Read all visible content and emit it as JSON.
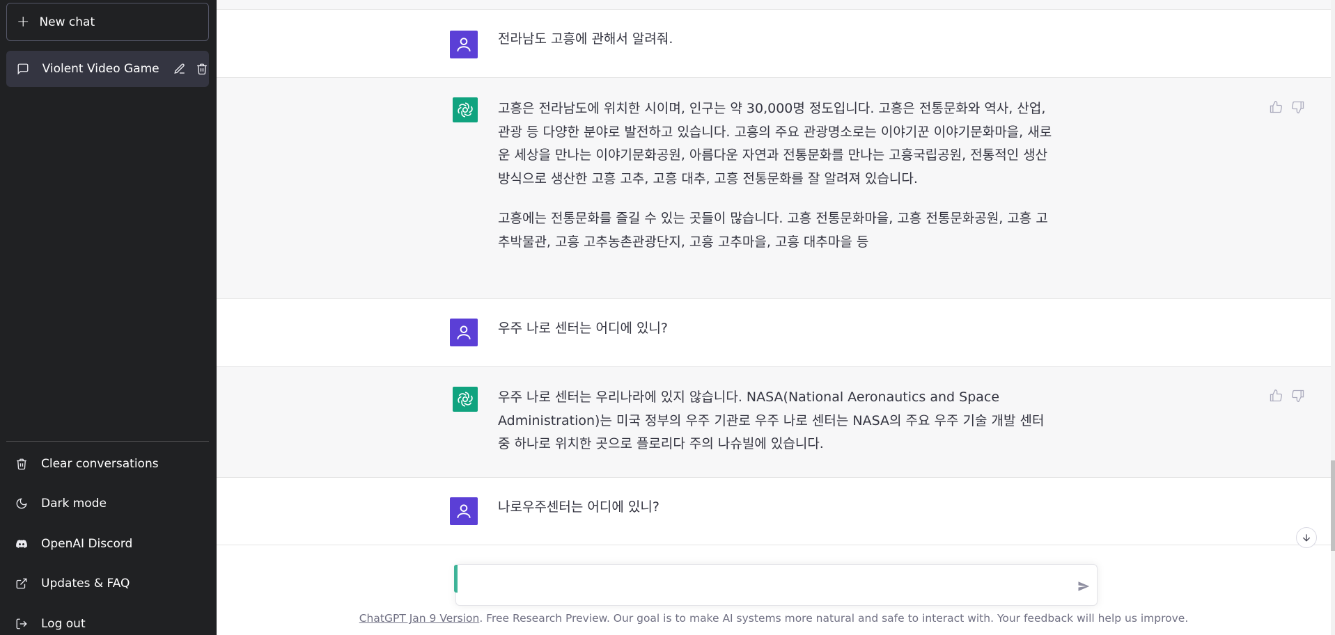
{
  "sidebar": {
    "new_chat_label": "New chat",
    "conversations": [
      {
        "title": "Violent Video Game Is"
      }
    ],
    "menu": [
      {
        "label": "Clear conversations",
        "icon": "trash-icon"
      },
      {
        "label": "Dark mode",
        "icon": "moon-icon"
      },
      {
        "label": "OpenAI Discord",
        "icon": "discord-icon"
      },
      {
        "label": "Updates & FAQ",
        "icon": "external-link-icon"
      },
      {
        "label": "Log out",
        "icon": "logout-icon"
      }
    ]
  },
  "messages": [
    {
      "role": "user",
      "text": "전라남도 고흥에 관해서 알려줘."
    },
    {
      "role": "assistant",
      "paragraphs": [
        "고흥은 전라남도에 위치한 시이며, 인구는 약 30,000명 정도입니다. 고흥은 전통문화와 역사, 산업, 관광 등 다양한 분야로 발전하고 있습니다. 고흥의 주요 관광명소로는 이야기꾼 이야기문화마을, 새로운 세상을 만나는 이야기문화공원, 아름다운 자연과 전통문화를 만나는 고흥국립공원, 전통적인 생산방식으로 생산한 고흥 고추, 고흥 대추, 고흥 전통문화를 잘 알려져 있습니다.",
        "고흥에는 전통문화를 즐길 수 있는 곳들이 많습니다. 고흥 전통문화마을, 고흥 전통문화공원, 고흥 고추박물관, 고흥 고추농촌관광단지, 고흥 고추마을, 고흥 대추마을 등"
      ]
    },
    {
      "role": "user",
      "text": "우주 나로 센터는 어디에 있니?"
    },
    {
      "role": "assistant",
      "paragraphs": [
        "우주 나로 센터는 우리나라에 있지 않습니다. NASA(National Aeronautics and Space Administration)는 미국 정부의 우주 기관로 우주 나로 센터는 NASA의 주요 우주 기술 개발 센터 중 하나로 위치한 곳으로 플로리다 주의 나슈빌에 있습니다."
      ]
    },
    {
      "role": "user",
      "text": "나로우주센터는 어디에 있니?"
    }
  ],
  "input": {
    "placeholder": "",
    "value": ""
  },
  "footer": {
    "link_text": "ChatGPT Jan 9 Version",
    "text": ". Free Research Preview. Our goal is to make AI systems more natural and safe to interact with. Your feedback will help us improve."
  },
  "colors": {
    "sidebar_bg": "#202123",
    "active_item_bg": "#343541",
    "user_avatar": "#5b3fd6",
    "assistant_avatar": "#10a37f",
    "assistant_bg": "#f7f7f8"
  }
}
